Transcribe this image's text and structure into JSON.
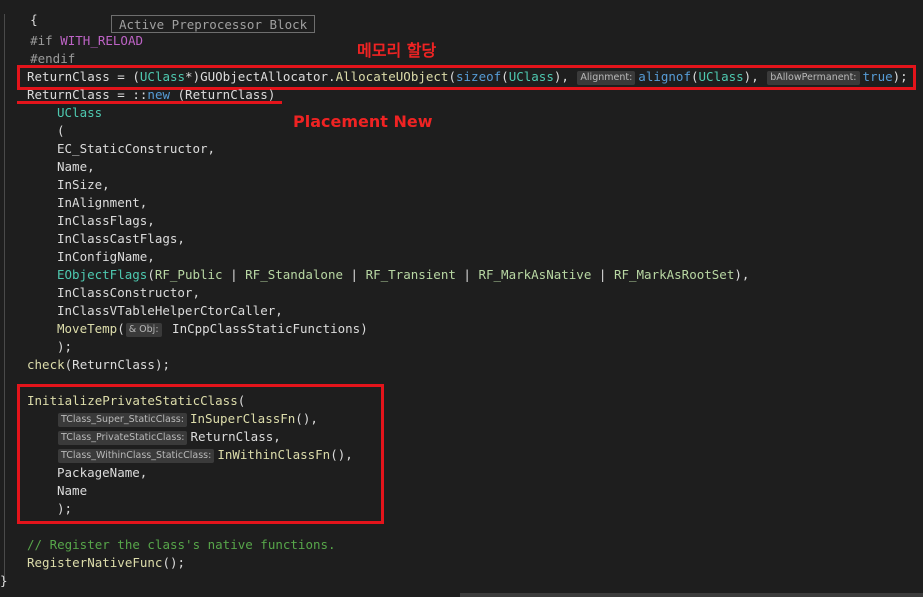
{
  "editor": {
    "preprocessor_tooltip": "Active Preprocessor Block",
    "annotations": {
      "memory_alloc": "메모리 할당",
      "placement_new": "Placement New"
    },
    "code": {
      "l0_brace": "{",
      "l1_if": "#if",
      "l1_macro": "WITH_RELOAD",
      "l2_endif": "#endif",
      "l3": {
        "a": "ReturnClass = (",
        "b": "UClass",
        "c": "*)",
        "d": "GUObjectAllocator",
        "e": ".",
        "f": "AllocateUObject",
        "g": "(",
        "h": "sizeof",
        "i": "(",
        "j": "UClass",
        "k": "), ",
        "hint1": "Alignment:",
        "l": "alignof",
        "m": "(",
        "n": "UClass",
        "o": "), ",
        "hint2": "bAllowPermanent:",
        "p": "true",
        "q": ");"
      },
      "l4": {
        "a": "ReturnClass = ::",
        "b": "new",
        "c": " (ReturnClass)"
      },
      "l5": "UClass",
      "l6": "(",
      "l7": "EC_StaticConstructor,",
      "l8": "Name,",
      "l9": "InSize,",
      "l10": "InAlignment,",
      "l11": "InClassFlags,",
      "l12": "InClassCastFlags,",
      "l13": "InConfigName,",
      "l14": {
        "a": "EObjectFlags",
        "b": "(",
        "c": "RF_Public",
        "d": " | ",
        "e": "RF_Standalone",
        "f": " | ",
        "g": "RF_Transient",
        "h": " | ",
        "i": "RF_MarkAsNative",
        "j": " | ",
        "k": "RF_MarkAsRootSet",
        "l": "),"
      },
      "l15": "InClassConstructor,",
      "l16": "InClassVTableHelperCtorCaller,",
      "l17": {
        "a": "MoveTemp",
        "b": "(",
        "hint": "& Obj:",
        "c": " InCppClassStaticFunctions)"
      },
      "l18": ");",
      "l19": {
        "a": "check",
        "b": "(ReturnClass);"
      },
      "l20": {
        "a": "InitializePrivateStaticClass",
        "b": "("
      },
      "l21": {
        "hint": "TClass_Super_StaticClass:",
        "a": "InSuperClassFn",
        "b": "(),"
      },
      "l22": {
        "hint": "TClass_PrivateStaticClass:",
        "a": "ReturnClass,"
      },
      "l23": {
        "hint": "TClass_WithinClass_StaticClass:",
        "a": "InWithinClassFn",
        "b": "(),"
      },
      "l24": "PackageName,",
      "l25": "Name",
      "l26": ");",
      "l27": "// Register the class's native functions.",
      "l28": {
        "a": "RegisterNativeFunc",
        "b": "();"
      },
      "l29": "}"
    }
  }
}
